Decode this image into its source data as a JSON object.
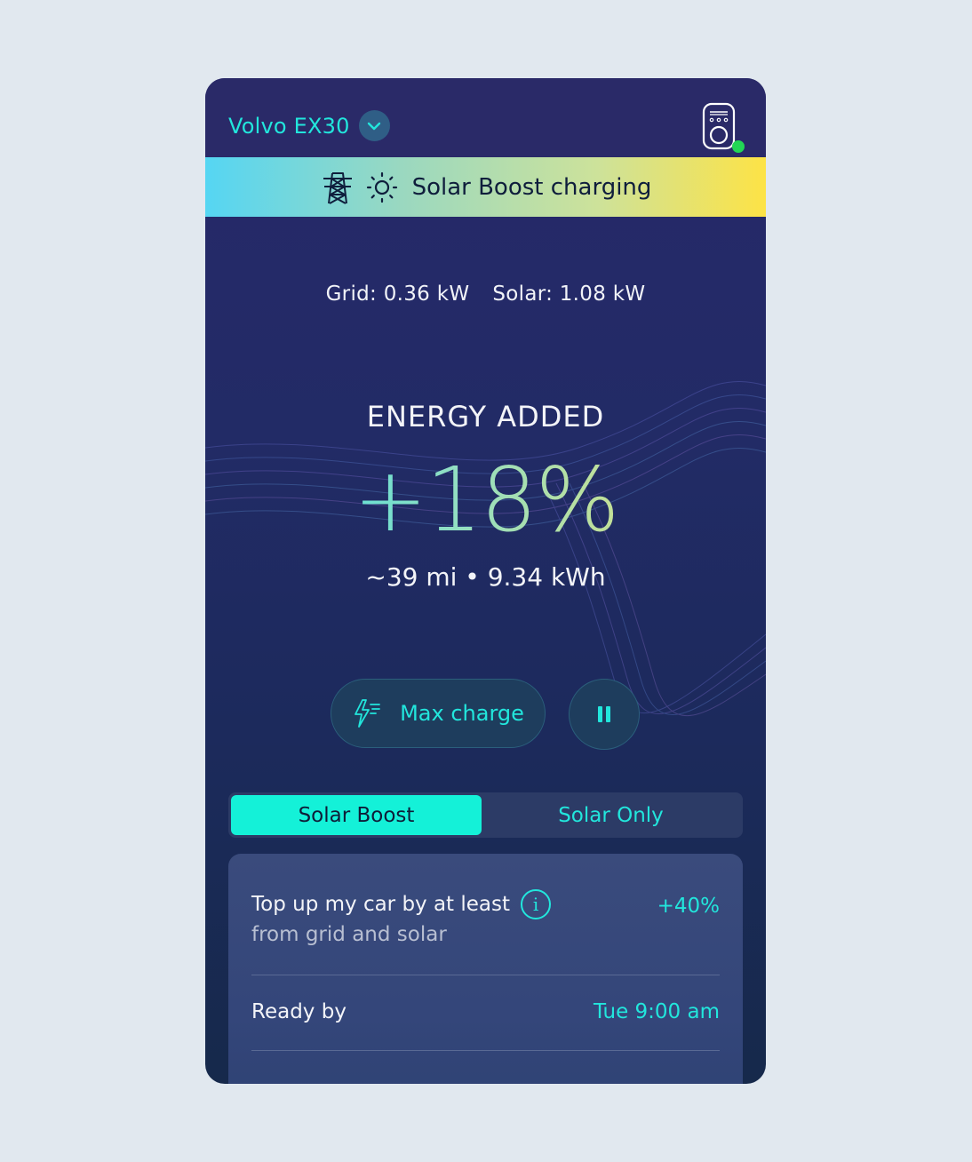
{
  "header": {
    "vehicle_name": "Volvo EX30",
    "charger_status": "online"
  },
  "banner": {
    "text": "Solar Boost charging",
    "icons": [
      "power-tower-icon",
      "sun-icon"
    ]
  },
  "power": {
    "grid": "Grid: 0.36 kW",
    "solar": "Solar: 1.08 kW"
  },
  "energy": {
    "label": "ENERGY ADDED",
    "value": "+18%",
    "sub": "~39 mi • 9.34 kWh"
  },
  "actions": {
    "max_charge_label": "Max charge",
    "pause_icon": "pause-icon"
  },
  "modes": {
    "tabs": [
      "Solar Boost",
      "Solar Only"
    ],
    "active": "Solar Boost"
  },
  "settings": {
    "topup_title": "Top up my car by at least",
    "topup_sub": "from grid and solar",
    "topup_value": "+40%",
    "ready_label": "Ready by",
    "ready_value": "Tue 9:00 am"
  },
  "colors": {
    "accent": "#22e6dc",
    "active_tab": "#14f1d8",
    "status_dot": "#22d655",
    "background": "#e1e8ef"
  }
}
